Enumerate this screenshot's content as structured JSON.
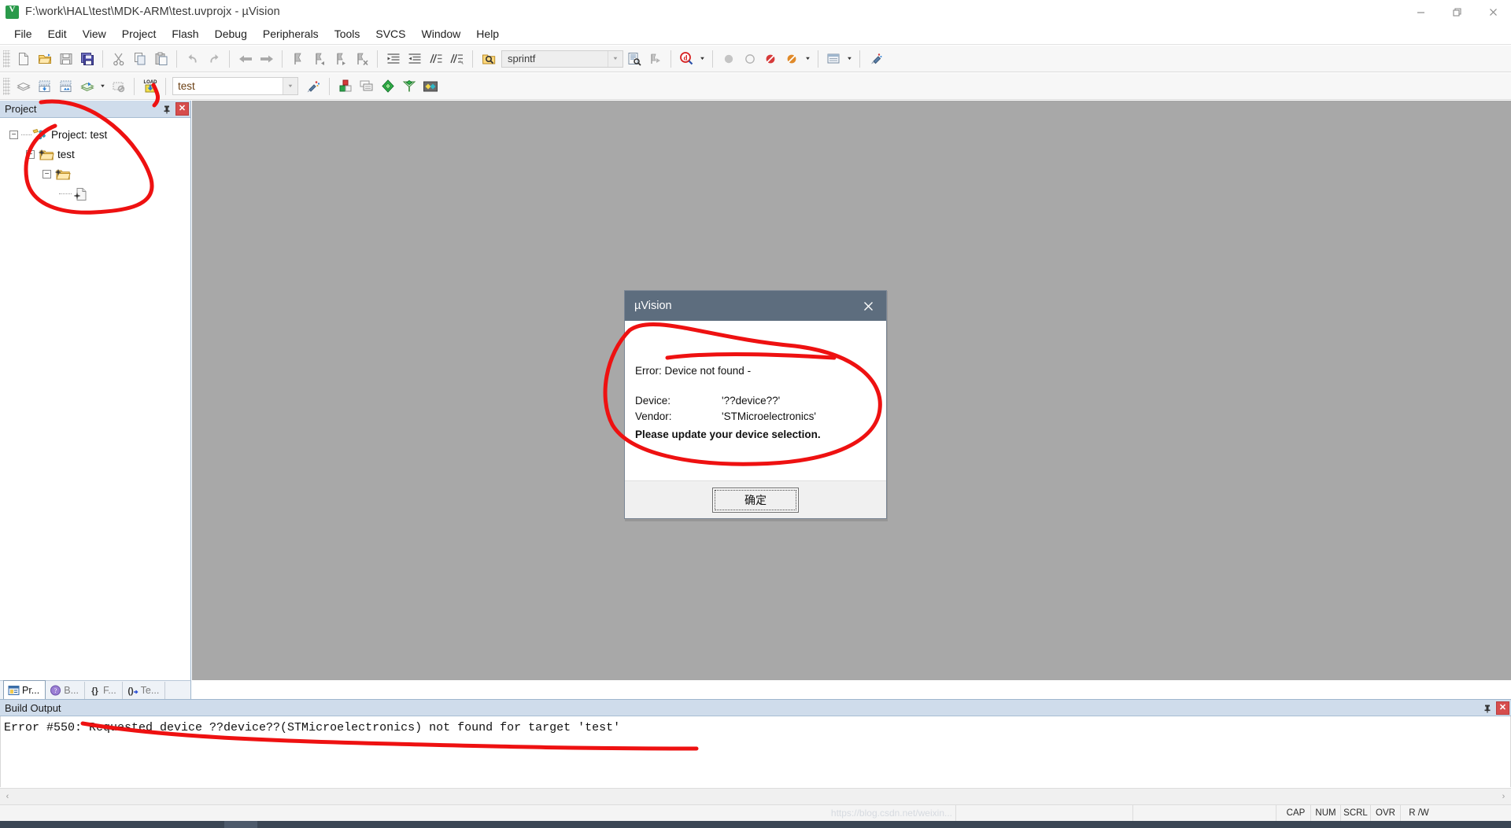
{
  "window": {
    "title": "F:\\work\\HAL\\test\\MDK-ARM\\test.uvprojx - µVision",
    "app_icon": "uvision-logo-icon",
    "minimize_label": "Minimize",
    "restore_label": "Restore",
    "close_label": "Close"
  },
  "menubar": {
    "items": [
      {
        "label": "File"
      },
      {
        "label": "Edit"
      },
      {
        "label": "View"
      },
      {
        "label": "Project"
      },
      {
        "label": "Flash"
      },
      {
        "label": "Debug"
      },
      {
        "label": "Peripherals"
      },
      {
        "label": "Tools"
      },
      {
        "label": "SVCS"
      },
      {
        "label": "Window"
      },
      {
        "label": "Help"
      }
    ]
  },
  "toolbar_main": {
    "buttons": [
      {
        "name": "new-file-icon",
        "tip": "New"
      },
      {
        "name": "open-file-icon",
        "tip": "Open"
      },
      {
        "name": "save-icon",
        "tip": "Save"
      },
      {
        "name": "save-all-icon",
        "tip": "Save All"
      },
      {
        "name": "cut-icon",
        "tip": "Cut"
      },
      {
        "name": "copy-icon",
        "tip": "Copy"
      },
      {
        "name": "paste-icon",
        "tip": "Paste"
      },
      {
        "name": "undo-icon",
        "tip": "Undo"
      },
      {
        "name": "redo-icon",
        "tip": "Redo"
      },
      {
        "name": "navigate-back-icon",
        "tip": "Back"
      },
      {
        "name": "navigate-forward-icon",
        "tip": "Forward"
      },
      {
        "name": "bookmark-toggle-icon",
        "tip": "Insert/Remove Bookmark"
      },
      {
        "name": "bookmark-prev-icon",
        "tip": "Previous Bookmark"
      },
      {
        "name": "bookmark-next-icon",
        "tip": "Next Bookmark"
      },
      {
        "name": "bookmark-clear-icon",
        "tip": "Clear All Bookmarks"
      },
      {
        "name": "indent-icon",
        "tip": "Indent"
      },
      {
        "name": "outdent-icon",
        "tip": "Outdent"
      },
      {
        "name": "comment-icon",
        "tip": "Comment"
      },
      {
        "name": "uncomment-icon",
        "tip": "Uncomment"
      },
      {
        "name": "find-in-files-icon",
        "tip": "Find in Files"
      }
    ],
    "search_combo": {
      "value": "sprintf",
      "placeholder": ""
    },
    "after_combo": [
      {
        "name": "incremental-find-icon",
        "tip": "Find"
      },
      {
        "name": "go-to-definition-icon",
        "tip": "Go To Definition"
      },
      {
        "name": "debug-search-icon",
        "tip": "Browse"
      },
      {
        "name": "breakpoint-icon",
        "tip": "Insert/Remove Breakpoint"
      },
      {
        "name": "disable-breakpoint-icon",
        "tip": "Disable Breakpoint"
      },
      {
        "name": "kill-breakpoints-icon",
        "tip": "Kill All Breakpoints"
      },
      {
        "name": "disable-all-breakpoints-icon",
        "tip": "Disable All Breakpoints"
      },
      {
        "name": "manage-components-icon",
        "tip": "Manage Components"
      },
      {
        "name": "config-wizard-icon",
        "tip": "Configuration Wizard"
      }
    ]
  },
  "toolbar_build": {
    "buttons": [
      {
        "name": "translate-icon",
        "tip": "Translate"
      },
      {
        "name": "build-target-icon",
        "tip": "Build"
      },
      {
        "name": "rebuild-all-icon",
        "tip": "Rebuild"
      },
      {
        "name": "batch-build-icon",
        "tip": "Batch Build"
      },
      {
        "name": "stop-build-icon",
        "tip": "Stop Build"
      },
      {
        "name": "download-icon",
        "tip": "Download"
      }
    ],
    "target_combo": {
      "value": "test"
    },
    "right_buttons": [
      {
        "name": "target-options-icon",
        "tip": "Options for Target"
      },
      {
        "name": "manage-project-items-icon",
        "tip": "Manage Project Items"
      },
      {
        "name": "multi-project-icon",
        "tip": "Multi-Project"
      },
      {
        "name": "pack-installer-icon",
        "tip": "Pack Installer"
      },
      {
        "name": "manage-run-time-icon",
        "tip": "Manage Run-Time Environment"
      },
      {
        "name": "software-packs-icon",
        "tip": "Select Software Packs"
      }
    ]
  },
  "project_panel": {
    "title": "Project",
    "pin_label": "Auto Hide",
    "close_label": "Close",
    "tree": [
      {
        "level": 0,
        "label": "Project: test",
        "icon": "project-icon",
        "expanded": true
      },
      {
        "level": 1,
        "label": "test",
        "icon": "target-folder-icon",
        "expanded": true
      },
      {
        "level": 2,
        "label": "",
        "icon": "group-folder-icon",
        "expanded": true
      },
      {
        "level": 3,
        "label": "",
        "icon": "source-file-icon",
        "expanded": null
      }
    ],
    "tabs": [
      {
        "label": "Pr...",
        "icon": "project-tab-icon",
        "active": true
      },
      {
        "label": "B...",
        "icon": "books-tab-icon",
        "active": false
      },
      {
        "label": "F...",
        "icon": "functions-tab-icon",
        "active": false
      },
      {
        "label": "Te...",
        "icon": "templates-tab-icon",
        "active": false
      }
    ]
  },
  "build_output": {
    "title": "Build Output",
    "pin_label": "Auto Hide",
    "close_label": "Close",
    "lines": [
      "Error #550: Requested device ??device??(STMicroelectronics) not found for target 'test'"
    ],
    "scroll_left": "‹",
    "scroll_right": "›"
  },
  "statusbar": {
    "watermark": "https://blog.csdn.net/weixin...",
    "indicators": [
      "CAP",
      "NUM",
      "SCRL",
      "OVR",
      "R /W"
    ]
  },
  "dialog": {
    "title": "µVision",
    "close_label": "Close",
    "error_text": "Error: Device not found -",
    "fields": [
      {
        "key": "Device:",
        "value": "'??device??'"
      },
      {
        "key": "Vendor:",
        "value": "'STMicroelectronics'"
      }
    ],
    "hint": "Please update your device selection.",
    "ok_label": "确定"
  },
  "colors": {
    "dialog_titlebar": "#5d6d7e",
    "panel_header": "#cfdceb",
    "mdi_background": "#a8a8a8",
    "annotation_red": "#ee1111",
    "close_button_red": "#d64d4d",
    "taskbar": "#3b4654"
  }
}
